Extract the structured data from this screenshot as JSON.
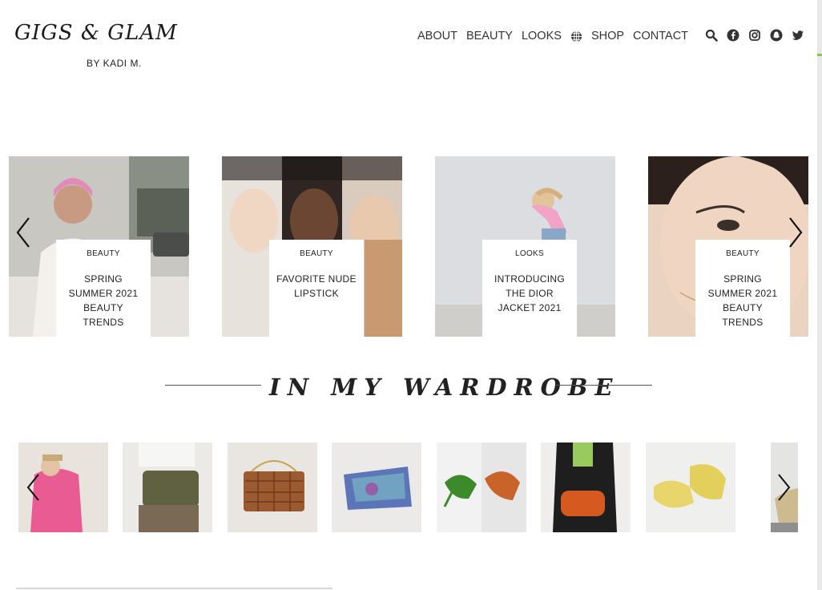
{
  "header": {
    "logo_title": "GIGS & GLAM",
    "logo_sub": "BY KADI M.",
    "nav": [
      "ABOUT",
      "BEAUTY",
      "LOOKS",
      "SHOP",
      "CONTACT"
    ],
    "social_icons": [
      "search-icon",
      "facebook-icon",
      "instagram-icon",
      "snapchat-icon",
      "twitter-icon"
    ]
  },
  "featured": {
    "cards": [
      {
        "category": "BEAUTY",
        "title": "SPRING SUMMER 2021 BEAUTY TRENDS"
      },
      {
        "category": "BEAUTY",
        "title": "FAVORITE NUDE LIPSTICK"
      },
      {
        "category": "LOOKS",
        "title": "INTRODUCING THE DIOR JACKET 2021"
      },
      {
        "category": "BEAUTY",
        "title": "SPRING SUMMER 2021 BEAUTY TRENDS"
      }
    ]
  },
  "wardrobe": {
    "title": "IN MY WARDROBE",
    "items": [
      "pink blazer look",
      "olive tote bag",
      "brown woven bag",
      "blue silk scarf",
      "green & orange sandals",
      "orange woven bag",
      "yellow ballet flats",
      "wedge espadrille"
    ]
  },
  "colors": {
    "accent": "#8bc34a",
    "text": "#222222"
  }
}
